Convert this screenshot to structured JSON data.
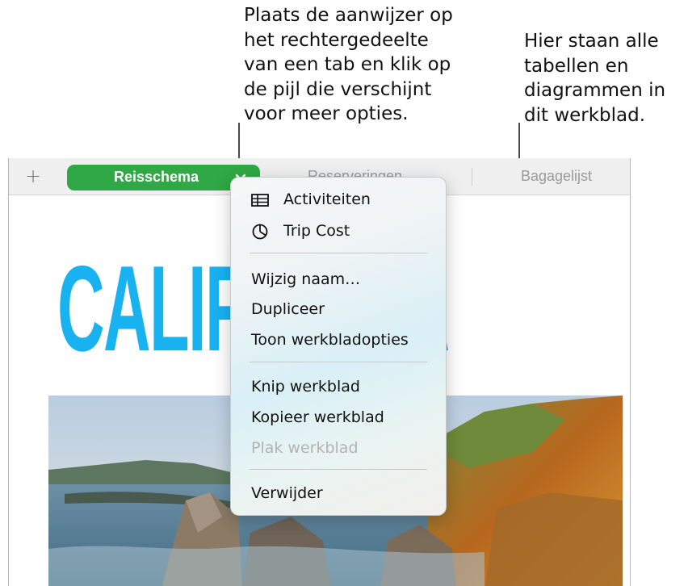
{
  "callouts": {
    "tab_menu": "Plaats de aanwijzer op\nhet rechtergedeelte\nvan een tab en klik op\nde pijl die verschijnt\nvoor meer opties.",
    "sheet_contents": "Hier staan alle\ntabellen en\ndiagrammen in\ndit werkblad."
  },
  "tabbar": {
    "add_label": "+",
    "active_tab": "Reisschema",
    "tabs": [
      "Reserveringen",
      "Bagagelijst"
    ]
  },
  "canvas": {
    "title": "CALIFORNIA"
  },
  "menu": {
    "objects": [
      {
        "label": "Activiteiten",
        "icon": "table-icon"
      },
      {
        "label": "Trip Cost",
        "icon": "pie-chart-icon"
      }
    ],
    "actions": [
      "Wijzig naam…",
      "Dupliceer",
      "Toon werkbladopties"
    ],
    "clipboard": [
      {
        "label": "Knip werkblad",
        "enabled": true
      },
      {
        "label": "Kopieer werkblad",
        "enabled": true
      },
      {
        "label": "Plak werkblad",
        "enabled": false
      }
    ],
    "delete": "Verwijder"
  },
  "colors": {
    "active_tab": "#2fa845",
    "title": "#19b2f0",
    "disabled_text": "#b3b3b3"
  }
}
